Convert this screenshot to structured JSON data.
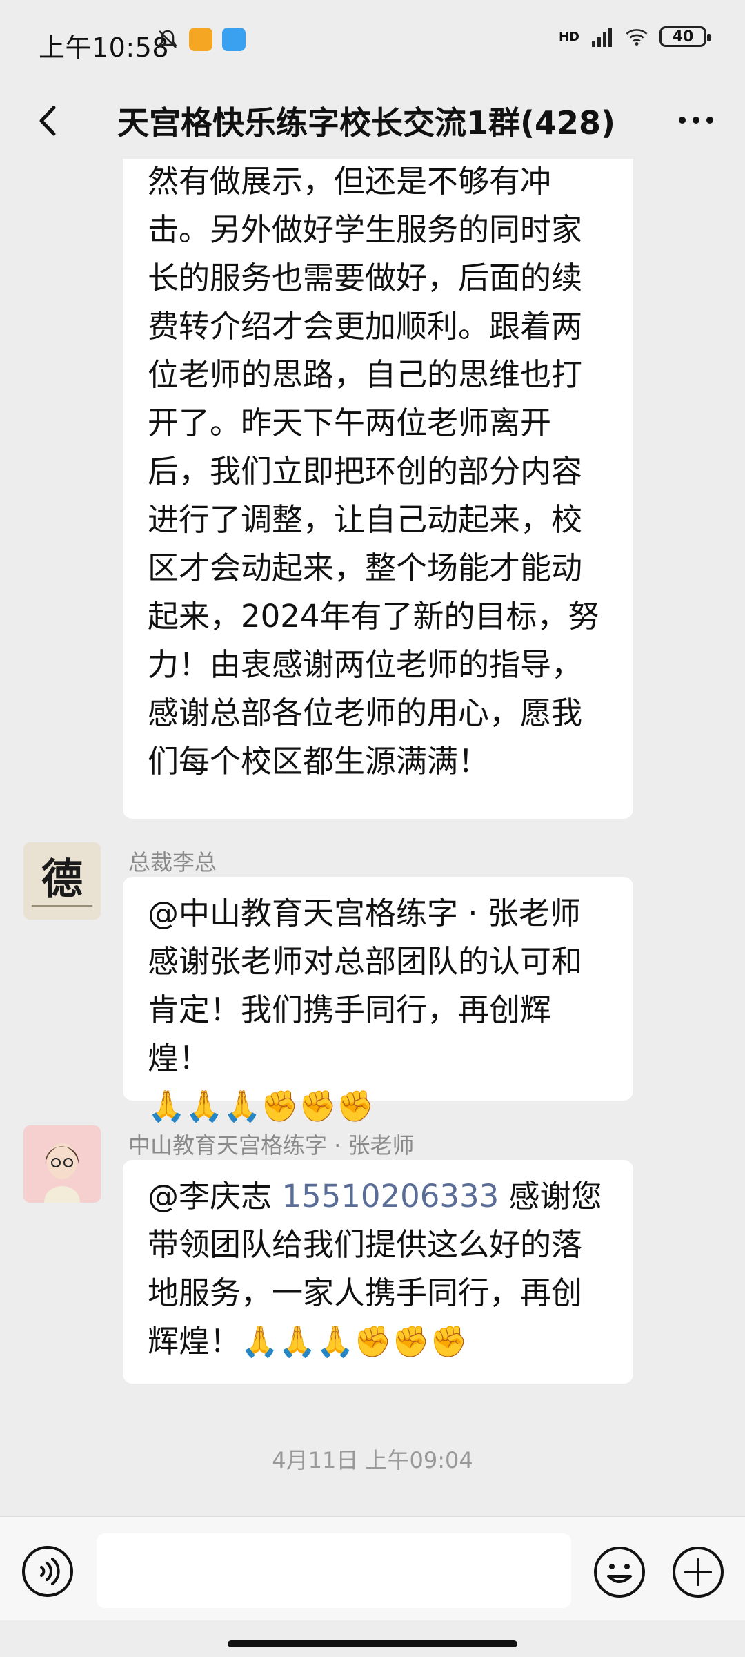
{
  "status_bar": {
    "time": "上午10:58",
    "network": "HD",
    "battery": "40"
  },
  "header": {
    "title": "天宫格快乐练字校长交流1群(428)"
  },
  "messages": [
    {
      "text": "然有做展示，但还是不够有冲击。另外做好学生服务的同时家长的服务也需要做好，后面的续费转介绍才会更加顺利。跟着两位老师的思路，自己的思维也打开了。昨天下午两位老师离开后，我们立即把环创的部分内容进行了调整，让自己动起来，校区才会动起来，整个场能才能动起来，2024年有了新的目标，努力！由衷感谢两位老师的指导，感谢总部各位老师的用心，愿我们每个校区都生源满满！"
    },
    {
      "sender": "总裁李总",
      "avatar_char": "德",
      "text": "@中山教育天宫格练字 · 张老师 感谢张老师对总部团队的认可和肯定！我们携手同行，再创辉煌！",
      "emojis": "🙏🙏🙏✊✊✊"
    },
    {
      "sender": "中山教育天宫格练字 · 张老师",
      "text_prefix": "@李庆志 ",
      "phone": "15510206333",
      "text_suffix": " 感谢您带领团队给我们提供这么好的落地服务，一家人携手同行，再创辉煌！",
      "emojis": "🙏🙏🙏✊✊✊"
    }
  ],
  "timestamp": "4月11日 上午09:04",
  "input": {
    "placeholder": ""
  }
}
